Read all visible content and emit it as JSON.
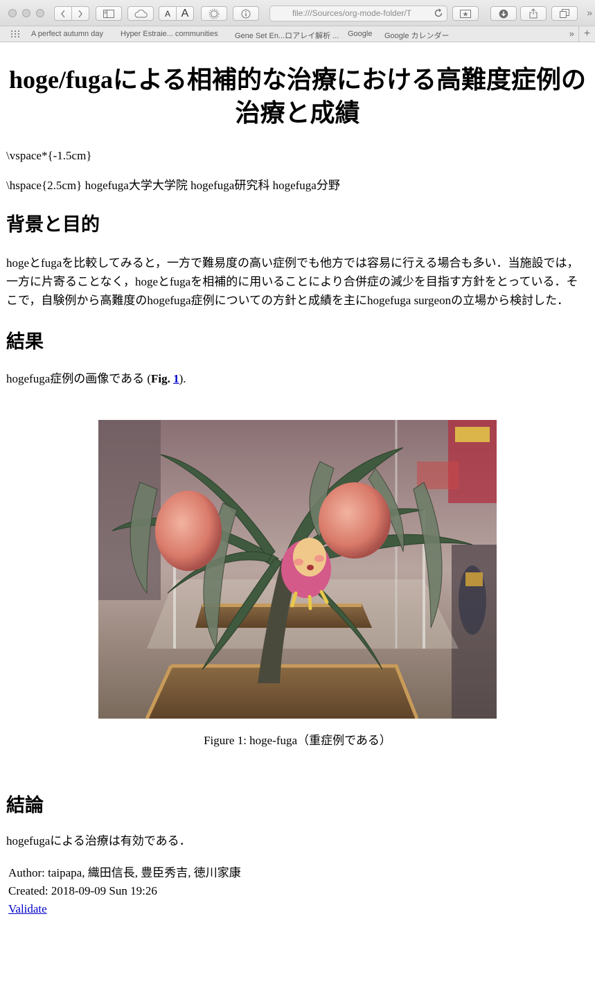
{
  "browser": {
    "url": "file:///Sources/org-mode-folder/T",
    "bookmarks": [
      "A perfect autumn day",
      "Hyper Estraie... communities",
      "Gene Set En...ロアレイ解析 ...",
      "Google",
      "Google カレンダー"
    ],
    "bookmarks_more": "»",
    "new_tab": "+",
    "text_smaller": "A",
    "text_larger": "A"
  },
  "document": {
    "title": "hoge/fugaによる相補的な治療における高難度症例の治療と成績",
    "vspace_line": "\\vspace*{-1.5cm}",
    "hspace_line": "\\hspace{2.5cm} hogefuga大学大学院 hogefuga研究科 hogefuga分野",
    "sections": {
      "background": {
        "heading": "背景と目的",
        "body": "hogeとfugaを比較してみると，一方で難易度の高い症例でも他方では容易に行える場合も多い．当施設では，一方に片寄ることなく，hogeとfugaを相補的に用いることにより合併症の減少を目指す方針をとっている．そこで，自験例から高難度のhogefuga症例についての方針と成績を主にhogefuga surgeonの立場から検討した．"
      },
      "results": {
        "heading": "結果",
        "body_prefix": "hogefuga症例の画像である (",
        "fig_label": "Fig.",
        "fig_number": "1",
        "body_suffix": ")."
      },
      "conclusion": {
        "heading": "結論",
        "body": "hogefugaによる治療は有効である．"
      }
    },
    "figure": {
      "caption": "Figure 1: hoge-fuga（重症例である）"
    },
    "postamble": {
      "author": "Author: taipapa, 織田信長, 豊臣秀吉, 徳川家康",
      "created": "Created: 2018-09-09 Sun 19:26",
      "validate": "Validate"
    }
  },
  "colors": {
    "link": "#0000cc",
    "chrome_bg": "#e4e4e4"
  }
}
